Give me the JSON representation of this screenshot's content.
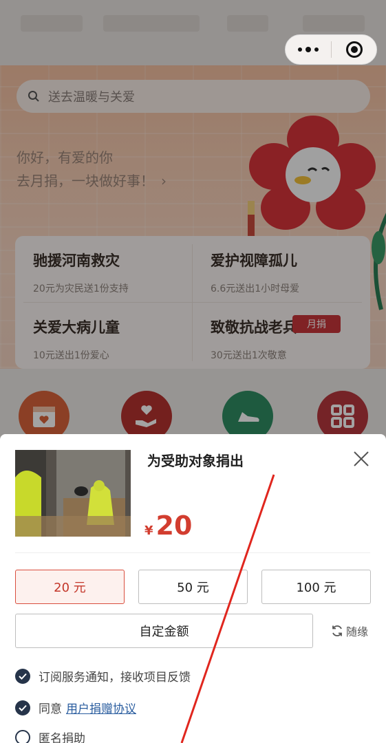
{
  "search": {
    "placeholder": "送去温暖与关爱"
  },
  "greeting": {
    "line1": "你好，有爱的你",
    "line2": "去月捐，一块做好事！",
    "arrow": "›"
  },
  "cards": [
    {
      "title": "驰援河南救灾",
      "subtitle": "20元为灾民送1份支持"
    },
    {
      "title": "爱护视障孤儿",
      "subtitle": "6.6元送出1小时母爱"
    },
    {
      "title": "关爱大病儿童",
      "subtitle": "10元送出1份爱心"
    },
    {
      "title": "致敬抗战老兵",
      "subtitle": "30元送出1次敬意"
    }
  ],
  "badge": "月捐",
  "icons": [
    "calendar-heart-icon",
    "hand-heart-icon",
    "shoe-icon",
    "grid-icon"
  ],
  "colors": {
    "accent": "#d23d2f",
    "icon1": "#d9633b",
    "icon2": "#b6332f",
    "icon3": "#2f8d63",
    "icon4": "#b8383e",
    "check": "#26344a"
  },
  "sheet": {
    "title": "为受助对象捐出",
    "currency": "¥",
    "amount": "20",
    "options": [
      "20 元",
      "50 元",
      "100 元"
    ],
    "selected_option": "20 元",
    "custom_label": "自定金额",
    "random_label": "随缘",
    "checks": [
      {
        "label": "订阅服务通知，接收项目反馈",
        "checked": true
      },
      {
        "prefix": "同意",
        "link": "用户捐赠协议",
        "checked": true
      },
      {
        "label": "匿名捐助",
        "checked": false
      }
    ]
  }
}
